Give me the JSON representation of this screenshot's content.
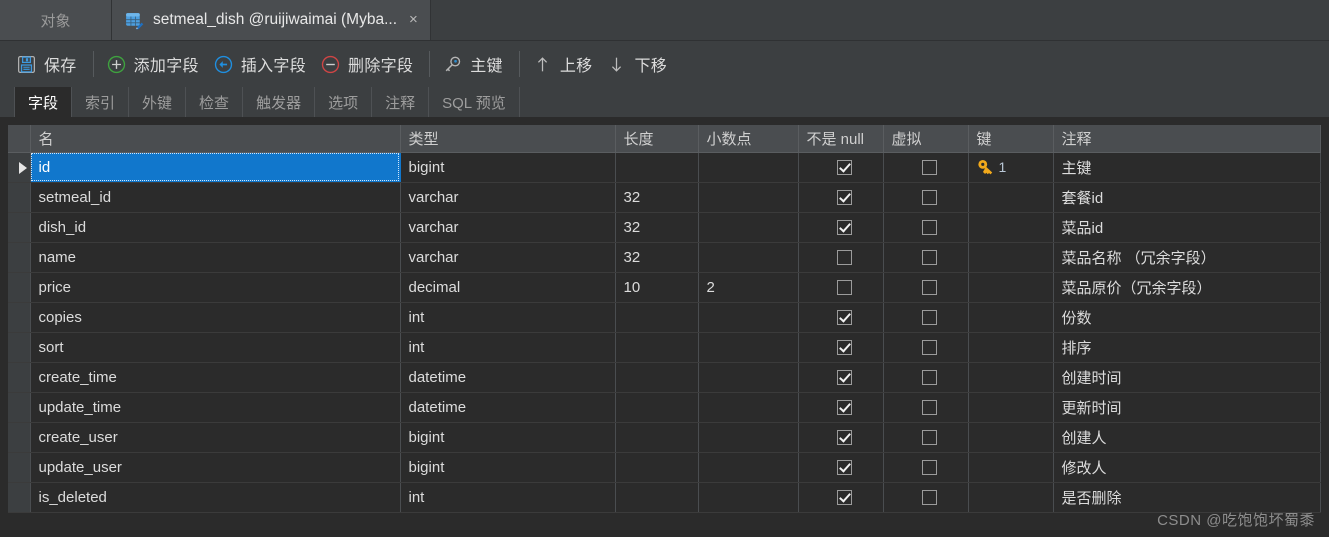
{
  "titlebar": {
    "object_tab": "对象",
    "doc_tab_label": "setmeal_dish @ruijiwaimai (Myba...",
    "doc_tab_icon": "table-edit-icon",
    "close_glyph": "×"
  },
  "toolbar": {
    "items": [
      {
        "label": "保存",
        "icon": "save-icon",
        "name": "save-button"
      },
      {
        "label": "添加字段",
        "icon": "add-circle-icon",
        "name": "add-field-button"
      },
      {
        "label": "插入字段",
        "icon": "insert-circle-icon",
        "name": "insert-field-button"
      },
      {
        "label": "删除字段",
        "icon": "delete-circle-icon",
        "name": "delete-field-button"
      },
      {
        "label": "主键",
        "icon": "key-icon",
        "name": "primary-key-button"
      },
      {
        "label": "上移",
        "icon": "arrow-up-icon",
        "name": "move-up-button"
      },
      {
        "label": "下移",
        "icon": "arrow-down-icon",
        "name": "move-down-button"
      }
    ]
  },
  "tabs": {
    "active": "字段",
    "items": [
      "字段",
      "索引",
      "外键",
      "检查",
      "触发器",
      "选项",
      "注释",
      "SQL 预览"
    ]
  },
  "grid": {
    "columns": [
      "名",
      "类型",
      "长度",
      "小数点",
      "不是 null",
      "虚拟",
      "键",
      "注释"
    ],
    "selected_row": 0,
    "selected_cell": "名",
    "rows": [
      {
        "name": "id",
        "type": "bigint",
        "length": "",
        "decimals": "",
        "not_null": true,
        "virtual": false,
        "key": "1",
        "comment": "主键"
      },
      {
        "name": "setmeal_id",
        "type": "varchar",
        "length": "32",
        "decimals": "",
        "not_null": true,
        "virtual": false,
        "key": "",
        "comment": "套餐id"
      },
      {
        "name": "dish_id",
        "type": "varchar",
        "length": "32",
        "decimals": "",
        "not_null": true,
        "virtual": false,
        "key": "",
        "comment": "菜品id"
      },
      {
        "name": "name",
        "type": "varchar",
        "length": "32",
        "decimals": "",
        "not_null": false,
        "virtual": false,
        "key": "",
        "comment": "菜品名称 （冗余字段）"
      },
      {
        "name": "price",
        "type": "decimal",
        "length": "10",
        "decimals": "2",
        "not_null": false,
        "virtual": false,
        "key": "",
        "comment": "菜品原价（冗余字段）"
      },
      {
        "name": "copies",
        "type": "int",
        "length": "",
        "decimals": "",
        "not_null": true,
        "virtual": false,
        "key": "",
        "comment": "份数"
      },
      {
        "name": "sort",
        "type": "int",
        "length": "",
        "decimals": "",
        "not_null": true,
        "virtual": false,
        "key": "",
        "comment": "排序"
      },
      {
        "name": "create_time",
        "type": "datetime",
        "length": "",
        "decimals": "",
        "not_null": true,
        "virtual": false,
        "key": "",
        "comment": "创建时间"
      },
      {
        "name": "update_time",
        "type": "datetime",
        "length": "",
        "decimals": "",
        "not_null": true,
        "virtual": false,
        "key": "",
        "comment": "更新时间"
      },
      {
        "name": "create_user",
        "type": "bigint",
        "length": "",
        "decimals": "",
        "not_null": true,
        "virtual": false,
        "key": "",
        "comment": "创建人"
      },
      {
        "name": "update_user",
        "type": "bigint",
        "length": "",
        "decimals": "",
        "not_null": true,
        "virtual": false,
        "key": "",
        "comment": "修改人"
      },
      {
        "name": "is_deleted",
        "type": "int",
        "length": "",
        "decimals": "",
        "not_null": true,
        "virtual": false,
        "key": "",
        "comment": "是否删除"
      }
    ]
  },
  "watermark": "CSDN @吃饱饱坏蜀黍",
  "colors": {
    "selection_blue": "#1177cc",
    "window_bg": "#3c3f41",
    "grid_bg": "#2b2b2b",
    "header_bg": "#4a4d50",
    "key_yellow": "#f2a91b",
    "add_green": "#3fa23f",
    "insert_blue": "#1f8fe0",
    "delete_red": "#d04545"
  }
}
